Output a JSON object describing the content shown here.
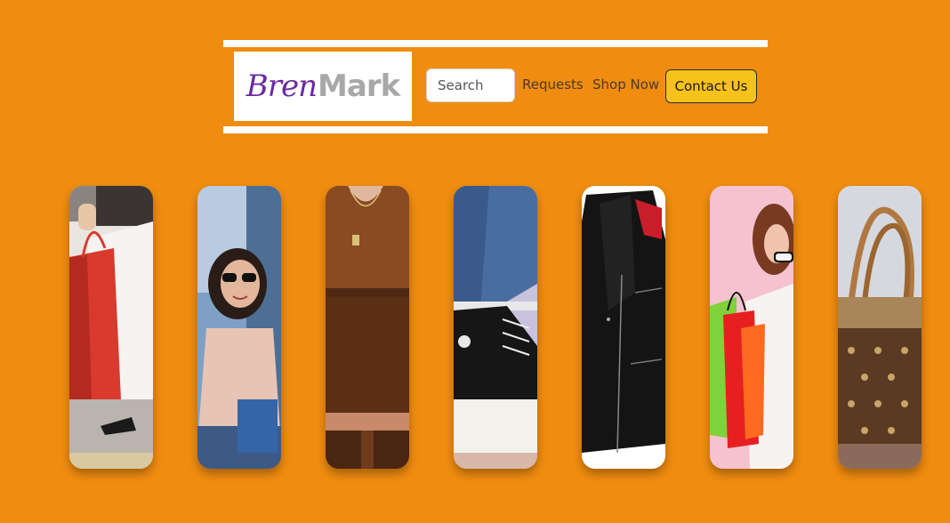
{
  "brand": {
    "logo_part1": "Bren",
    "logo_part2": "Mark"
  },
  "nav": {
    "search_placeholder": "Search",
    "requests_label": "Requests",
    "shop_now_label": "Shop Now",
    "contact_label": "Contact Us"
  },
  "gallery": {
    "items": [
      {
        "subject": "shopping bags held in hand"
      },
      {
        "subject": "woman in sunglasses with shopping bag"
      },
      {
        "subject": "brown knit outfit with pendant necklace"
      },
      {
        "subject": "black platform sneakers with jeans"
      },
      {
        "subject": "black leather jacket"
      },
      {
        "subject": "woman with colorful shopping bags"
      },
      {
        "subject": "brown monogram handbag"
      }
    ]
  },
  "colors": {
    "background": "#f08c10",
    "accent_button": "#f7c21a",
    "logo_purple": "#6a2aa0",
    "logo_gray": "#a8a8a8"
  }
}
